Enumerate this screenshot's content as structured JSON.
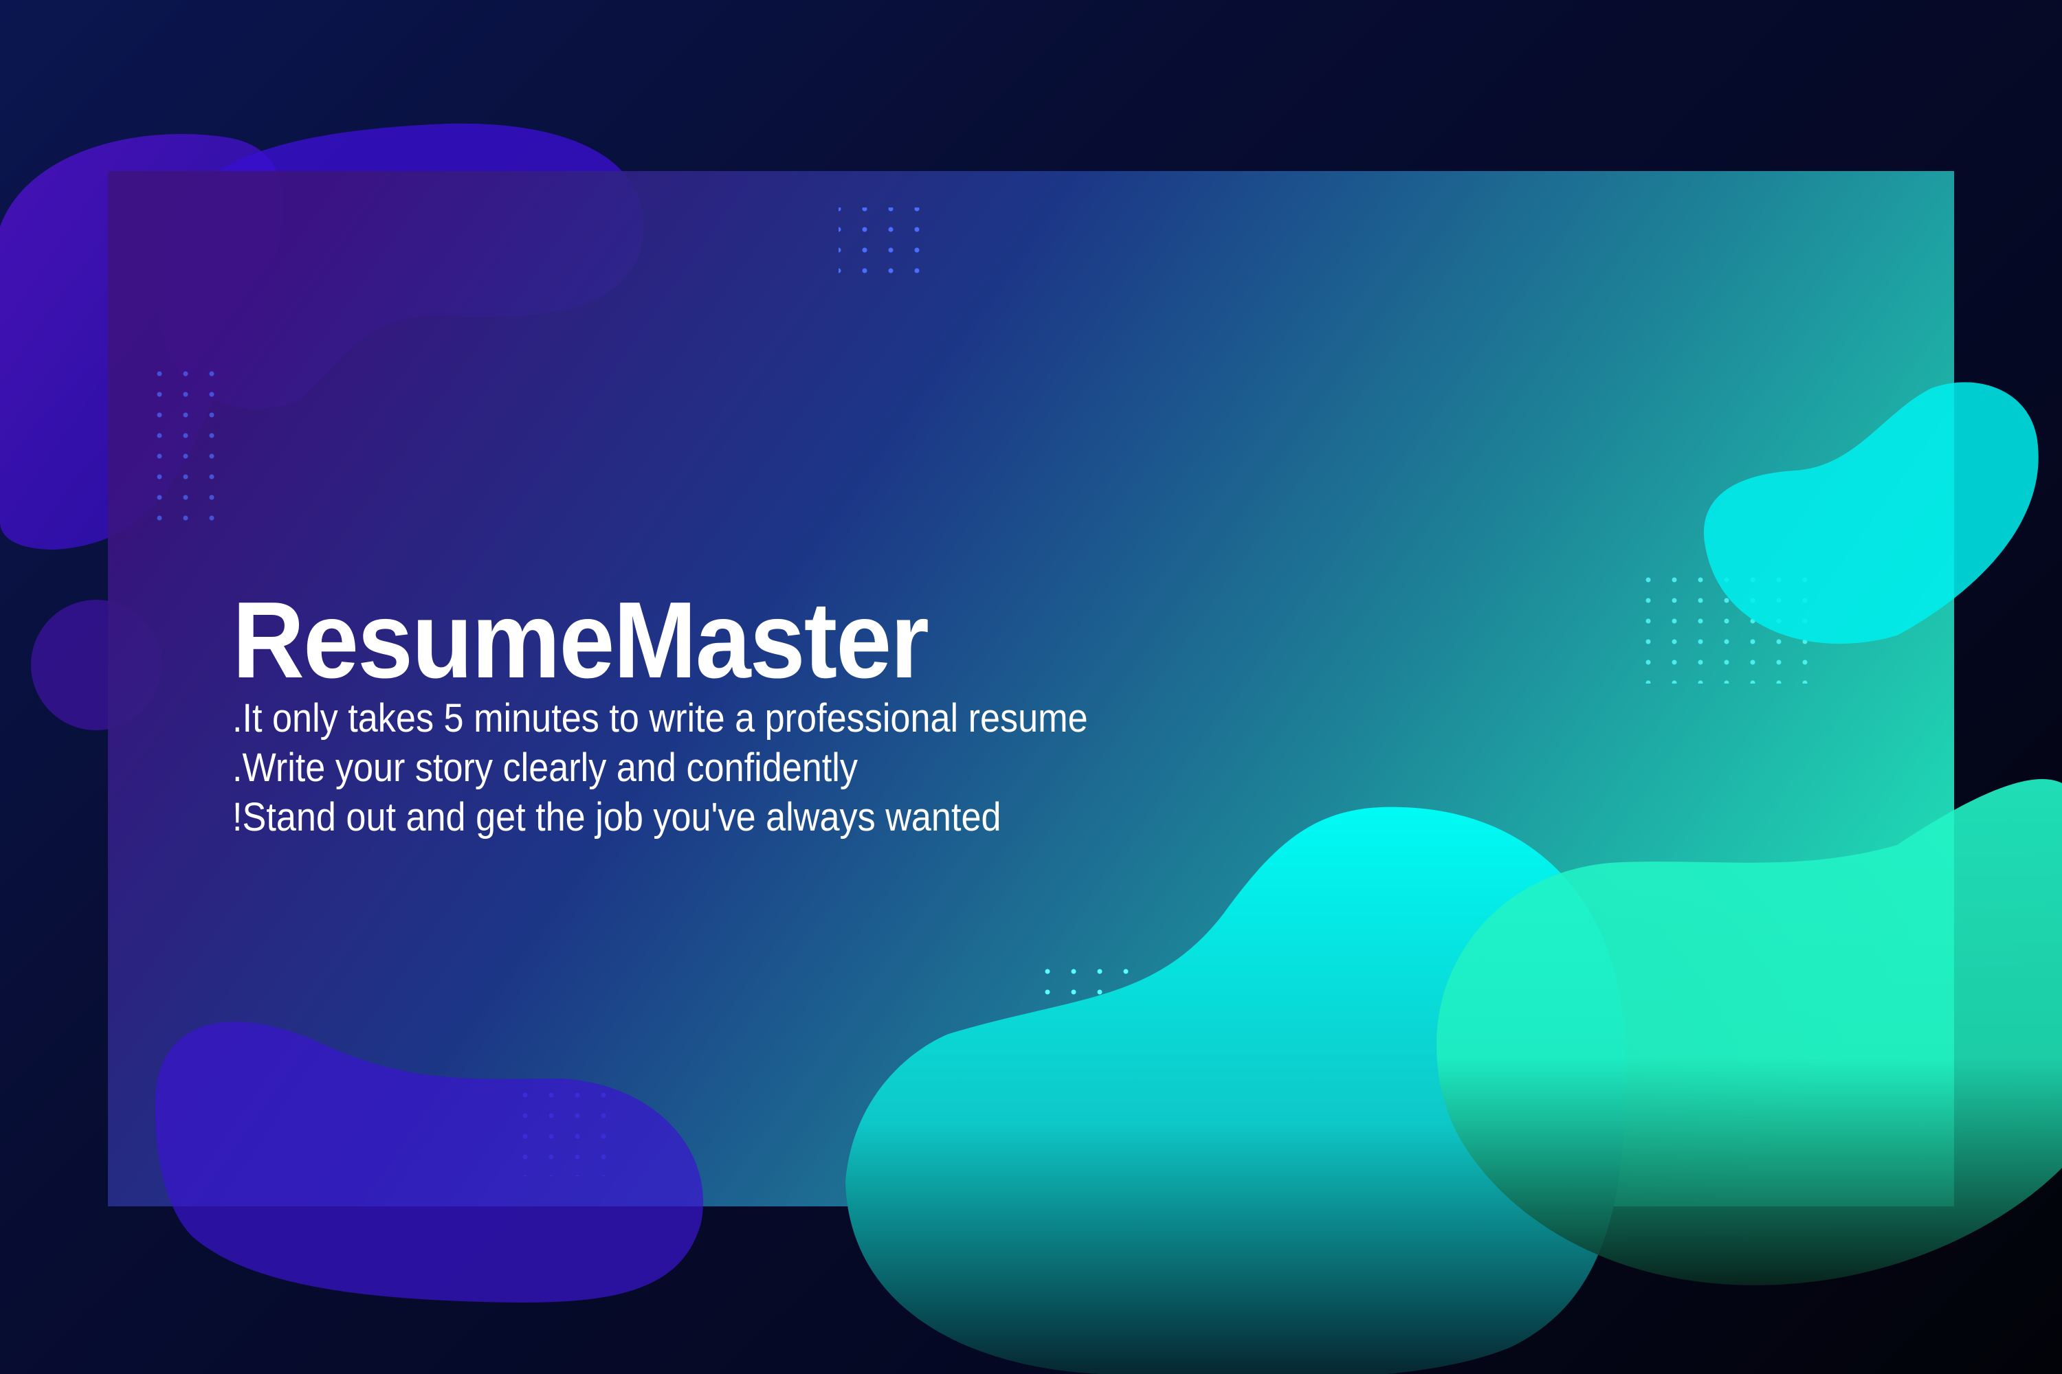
{
  "banner": {
    "title": "ResumeMaster",
    "lines": [
      ".It only takes 5 minutes to write a professional resume",
      ".Write your story clearly and confidently",
      "!Stand out and get the job you've always wanted"
    ]
  },
  "colors": {
    "background": "#060a2a",
    "panel_start": "#3a1080",
    "panel_mid": "#1e3f8f",
    "panel_end": "#22e6c0",
    "blob_purple": "#3a0fd0",
    "blob_cyan": "#00f5f0",
    "blob_green": "#20f5c0"
  }
}
